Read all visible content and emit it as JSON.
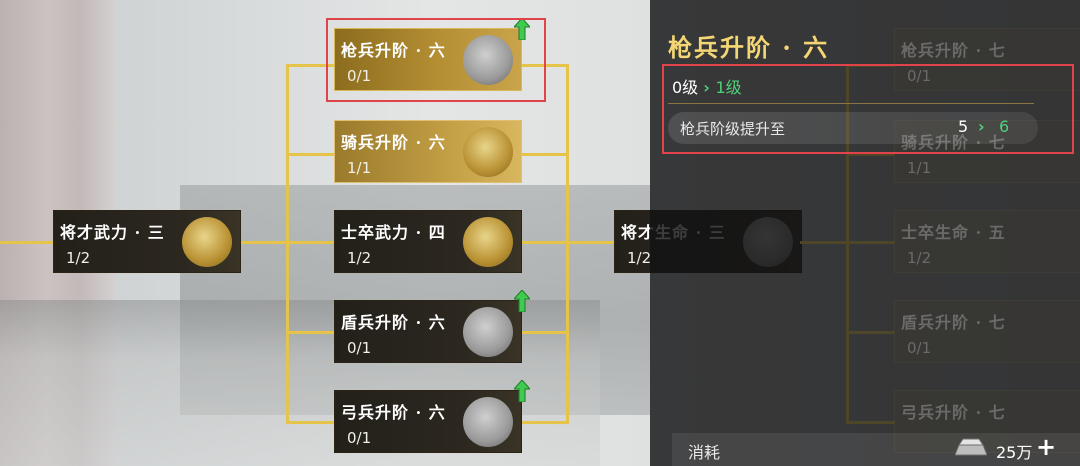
{
  "tree": {
    "nodes": [
      {
        "id": "qiang",
        "title": "枪兵升阶 · 六",
        "count": "0/1",
        "upgrade": true
      },
      {
        "id": "qi",
        "title": "骑兵升阶 · 六",
        "count": "1/1",
        "upgrade": false
      },
      {
        "id": "jiangcai",
        "title": "将才武力 · 三",
        "count": "1/2",
        "upgrade": false
      },
      {
        "id": "shizu",
        "title": "士卒武力 · 四",
        "count": "1/2",
        "upgrade": false
      },
      {
        "id": "jiangcai_sm",
        "title": "将才生命 · 三",
        "count": "1/2",
        "upgrade": false
      },
      {
        "id": "dun",
        "title": "盾兵升阶 · 六",
        "count": "0/1",
        "upgrade": true
      },
      {
        "id": "gong",
        "title": "弓兵升阶 · 六",
        "count": "0/1",
        "upgrade": true
      }
    ],
    "faded_nodes": [
      {
        "title": "枪兵升阶 · 七",
        "count": "0/1"
      },
      {
        "title": "骑兵升阶 · 七",
        "count": "1/1"
      },
      {
        "title": "士卒生命 · 五",
        "count": "1/2"
      },
      {
        "title": "盾兵升阶 · 七",
        "count": "0/1"
      },
      {
        "title": "弓兵升阶 · 七",
        "count": ""
      }
    ]
  },
  "panel": {
    "title": "枪兵升阶 · 六",
    "level_from": "0级",
    "level_to": "1级",
    "stat_label": "枪兵阶级提升至",
    "stat_from": "5",
    "stat_to": "6",
    "cost_label": "消耗",
    "cost_value": "25万",
    "plus": "+"
  },
  "colors": {
    "gold_text": "#f4d774",
    "green": "#4ed07a",
    "highlight": "#e0434a",
    "connector": "#e6c44a"
  },
  "icons": {
    "upgrade": "green-up-arrow-icon",
    "chevron": "chevron-right-icon",
    "currency": "silver-ingot-icon"
  }
}
